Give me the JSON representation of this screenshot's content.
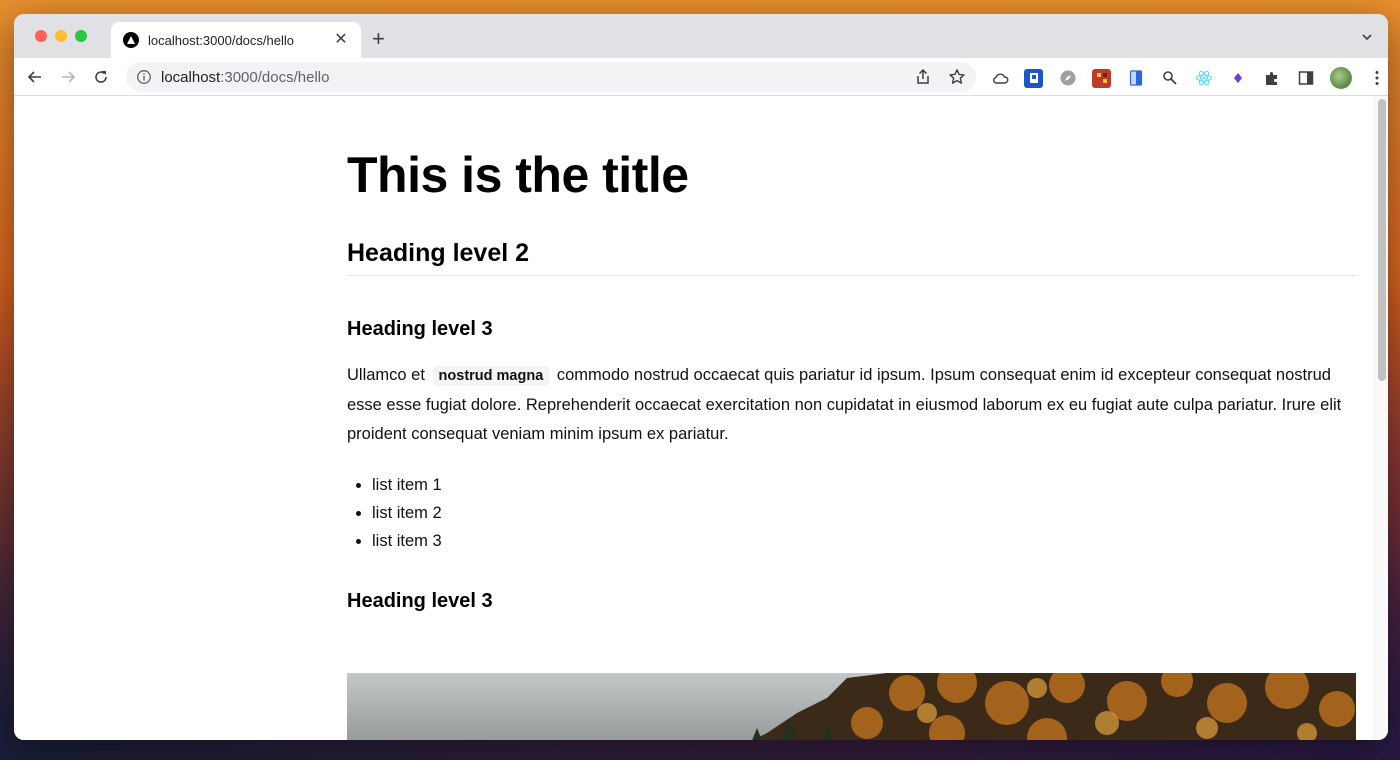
{
  "browser": {
    "tab": {
      "title": "localhost:3000/docs/hello"
    },
    "address_bar": {
      "host": "localhost",
      "rest": ":3000/docs/hello"
    },
    "extensions": [
      "cloud-icon",
      "extension-blue-icon",
      "compass-icon",
      "extension-red-icon",
      "document-icon",
      "magnifier-icon",
      "react-icon",
      "diamond-icon",
      "puzzle-icon"
    ],
    "colors": {
      "tabstrip": "#dfe1e5",
      "omnibox": "#f1f3f4"
    }
  },
  "page": {
    "title": "This is the title",
    "h2": "Heading level 2",
    "h3_first": "Heading level 3",
    "paragraph": {
      "before": "Ullamco et",
      "code": "nostrud magna",
      "after": "commodo nostrud occaecat quis pariatur id ipsum. Ipsum consequat enim id excepteur consequat nostrud esse esse fugiat dolore. Reprehenderit occaecat exercitation non cupidatat in eiusmod laborum ex eu fugiat aute culpa pariatur. Irure elit proident consequat veniam minim ipsum ex pariatur."
    },
    "list": [
      "list item 1",
      "list item 2",
      "list item 3"
    ],
    "h3_second": "Heading level 3"
  }
}
